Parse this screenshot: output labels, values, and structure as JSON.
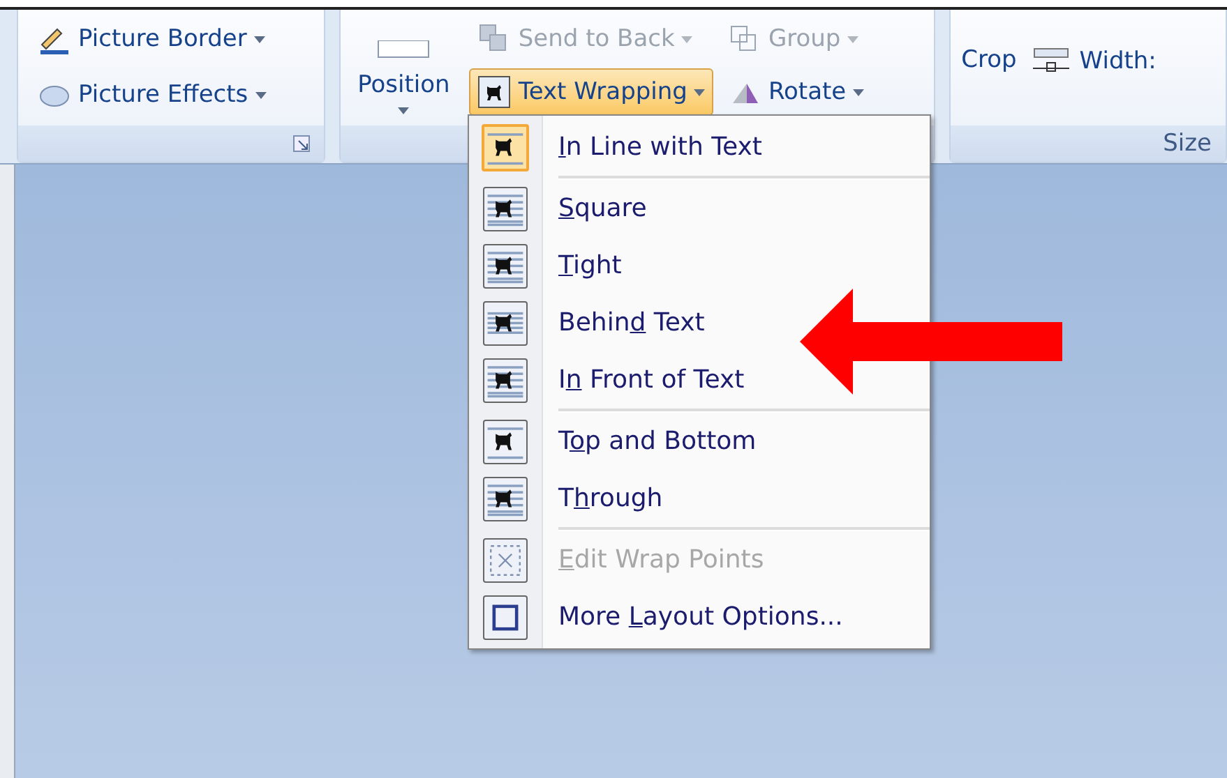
{
  "ribbon": {
    "groups": [
      {
        "kind": "adjust",
        "buttons": [
          {
            "label": "Picture Border",
            "kind": "border",
            "disabled": false
          },
          {
            "label": "Picture Effects",
            "kind": "effects",
            "disabled": false
          }
        ],
        "launcher": true
      },
      {
        "kind": "arrange",
        "big_button": {
          "label": "Position"
        },
        "buttons": [
          {
            "label": "Send to Back",
            "kind": "send-back",
            "disabled": true,
            "selected": false
          },
          {
            "label": "Group",
            "kind": "group",
            "disabled": true,
            "selected": false
          },
          {
            "label": "Text Wrapping",
            "kind": "wrap",
            "disabled": false,
            "selected": true
          },
          {
            "label": "Rotate",
            "kind": "rotate",
            "disabled": false,
            "selected": false
          }
        ]
      },
      {
        "kind": "size",
        "crop": "Crop",
        "width_label": "Width:",
        "label": "Size"
      }
    ]
  },
  "menu": {
    "items": [
      {
        "key": "I",
        "after": "n Line with Text",
        "kind": "inline",
        "selected": true,
        "disabled": false,
        "separator_after": true
      },
      {
        "key": "S",
        "after": "quare",
        "kind": "square",
        "selected": false,
        "disabled": false,
        "separator_after": false
      },
      {
        "key": "T",
        "after": "ight",
        "kind": "tight",
        "selected": false,
        "disabled": false,
        "separator_after": false
      },
      {
        "before": "Behin",
        "key": "d",
        "after": " Text",
        "kind": "behind",
        "selected": false,
        "disabled": false,
        "separator_after": false
      },
      {
        "before": "I",
        "key": "n",
        "after": " Front of Text",
        "kind": "front",
        "selected": false,
        "disabled": false,
        "separator_after": true
      },
      {
        "before": "T",
        "key": "o",
        "after": "p and Bottom",
        "kind": "topbottom",
        "selected": false,
        "disabled": false,
        "separator_after": false
      },
      {
        "before": "T",
        "key": "h",
        "after": "rough",
        "kind": "through",
        "selected": false,
        "disabled": false,
        "separator_after": true
      },
      {
        "key": "E",
        "after": "dit Wrap Points",
        "kind": "points",
        "selected": false,
        "disabled": true,
        "separator_after": false
      },
      {
        "before": "More ",
        "key": "L",
        "after": "ayout Options...",
        "kind": "layout",
        "selected": false,
        "disabled": false,
        "separator_after": false
      }
    ]
  },
  "annotation": {
    "kind": "arrow",
    "color": "#ff0000"
  }
}
